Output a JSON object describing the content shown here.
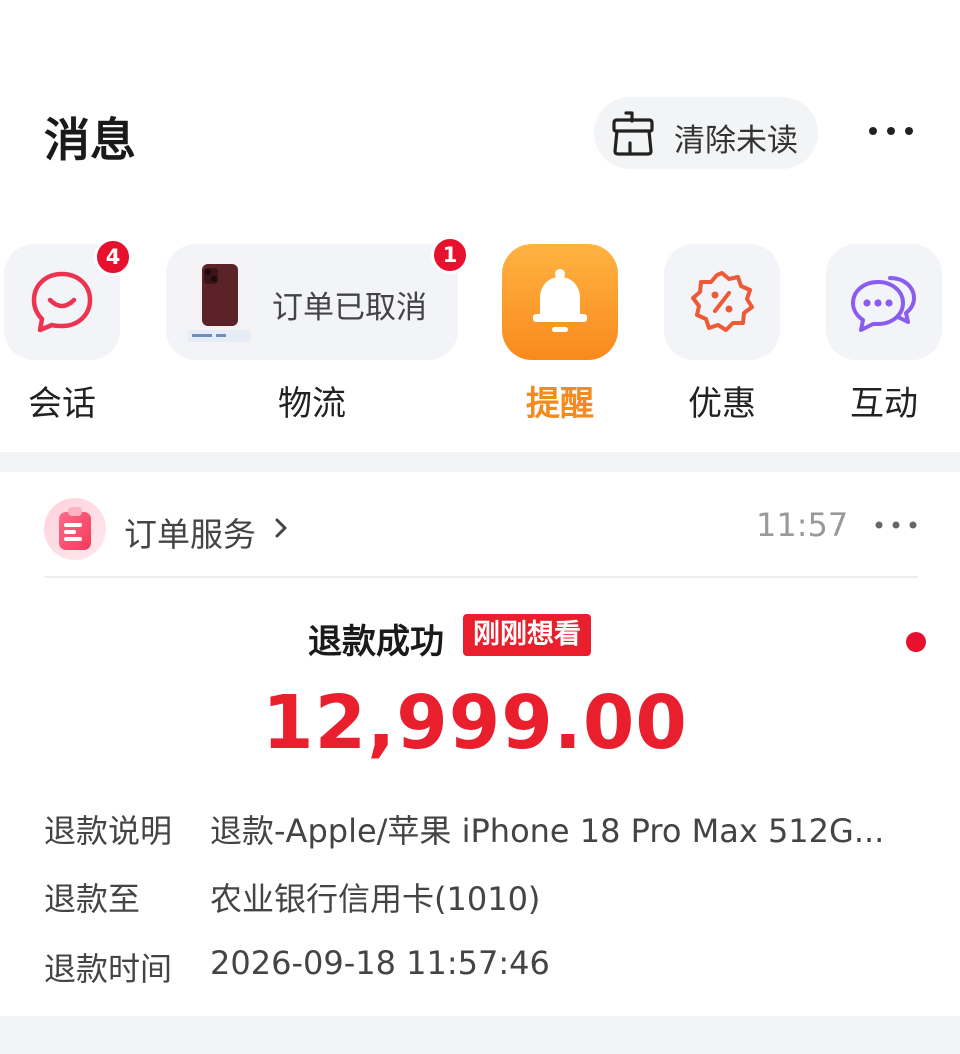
{
  "header": {
    "title": "消息",
    "clear_label": "清除未读"
  },
  "categories": [
    {
      "label": "会话",
      "badge": "4",
      "icon": "chat-smile-icon"
    },
    {
      "label": "物流",
      "badge": "1",
      "preview": "订单已取消",
      "icon": "phone-thumbnail"
    },
    {
      "label": "提醒",
      "active": true,
      "icon": "bell-icon"
    },
    {
      "label": "优惠",
      "icon": "discount-badge-icon"
    },
    {
      "label": "互动",
      "icon": "speech-bubbles-icon"
    }
  ],
  "colors": {
    "accent_orange": "#f58a1f",
    "red": "#ea1f2e",
    "tile_bg": "#f3f4f8"
  },
  "message": {
    "service": "订单服务",
    "time": "11:57",
    "refund_title": "退款成功",
    "tag": "刚刚想看",
    "amount": "12,999.00",
    "rows": [
      {
        "key": "退款说明",
        "value": "退款-Apple/苹果 iPhone 18 Pro Max 512G..."
      },
      {
        "key": "退款至",
        "value": "农业银行信用卡(1010)"
      },
      {
        "key": "退款时间",
        "value": "2026-09-18 11:57:46"
      }
    ]
  }
}
